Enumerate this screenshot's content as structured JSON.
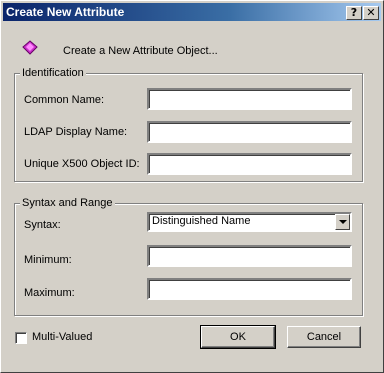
{
  "window": {
    "title": "Create New Attribute",
    "help_glyph": "?",
    "close_glyph": "✕"
  },
  "header": {
    "description": "Create a New Attribute Object..."
  },
  "identification": {
    "legend": "Identification",
    "common_name_label": "Common Name:",
    "common_name_value": "",
    "ldap_label": "LDAP Display Name:",
    "ldap_value": "",
    "x500_label": "Unique X500 Object ID:",
    "x500_value": ""
  },
  "syntax_range": {
    "legend": "Syntax and Range",
    "syntax_label": "Syntax:",
    "syntax_value": "Distinguished Name",
    "minimum_label": "Minimum:",
    "minimum_value": "",
    "maximum_label": "Maximum:",
    "maximum_value": ""
  },
  "options": {
    "multivalued_label": "Multi-Valued",
    "multivalued_checked": false
  },
  "buttons": {
    "ok": "OK",
    "cancel": "Cancel"
  },
  "colors": {
    "titlebar_start": "#0a246a",
    "titlebar_end": "#a6caf0",
    "icon_accent": "#cc00cc"
  }
}
